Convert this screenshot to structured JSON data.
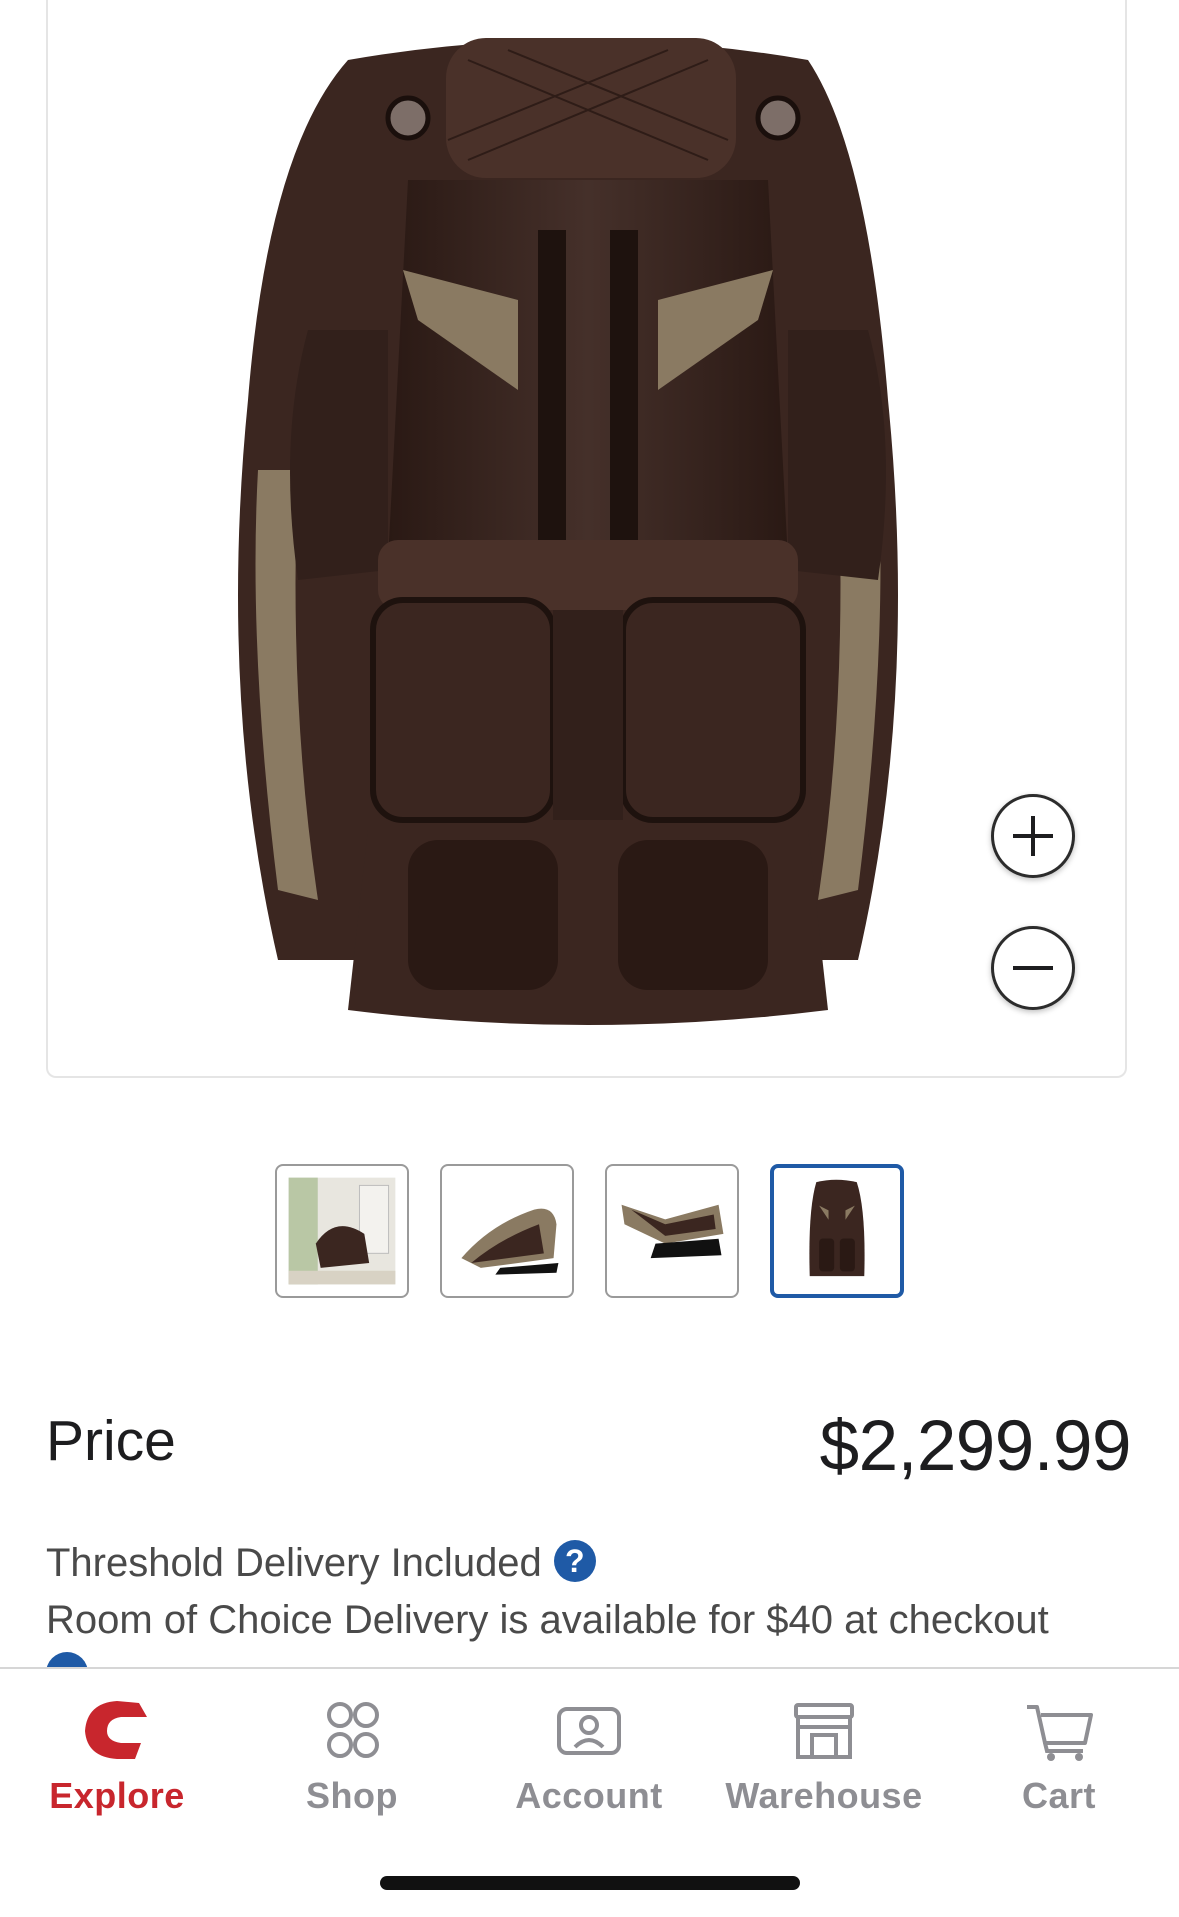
{
  "product": {
    "image_alt": "Brown massage chair",
    "zoom_in_label": "+",
    "zoom_out_label": "−"
  },
  "thumbnails": [
    {
      "name": "lifestyle-photo",
      "active": false
    },
    {
      "name": "side-view-upright",
      "active": false
    },
    {
      "name": "side-view-reclined",
      "active": false
    },
    {
      "name": "front-view",
      "active": true
    }
  ],
  "pricing": {
    "label": "Price",
    "value": "$2,299.99"
  },
  "delivery": {
    "line1": "Threshold Delivery Included",
    "line2": "Room of Choice Delivery is available for $40 at checkout",
    "help_glyph": "?"
  },
  "tabbar": {
    "tabs": [
      {
        "label": "Explore",
        "icon": "costco-c-icon",
        "active": true
      },
      {
        "label": "Shop",
        "icon": "grid-circles-icon",
        "active": false
      },
      {
        "label": "Account",
        "icon": "account-card-icon",
        "active": false
      },
      {
        "label": "Warehouse",
        "icon": "warehouse-icon",
        "active": false
      },
      {
        "label": "Cart",
        "icon": "cart-icon",
        "active": false
      }
    ]
  },
  "colors": {
    "accent_red": "#c8262d",
    "accent_blue": "#1f5aa6",
    "chair_dark": "#3b2620",
    "chair_tan": "#8a7a62",
    "inactive_tab": "#8e8e93"
  }
}
